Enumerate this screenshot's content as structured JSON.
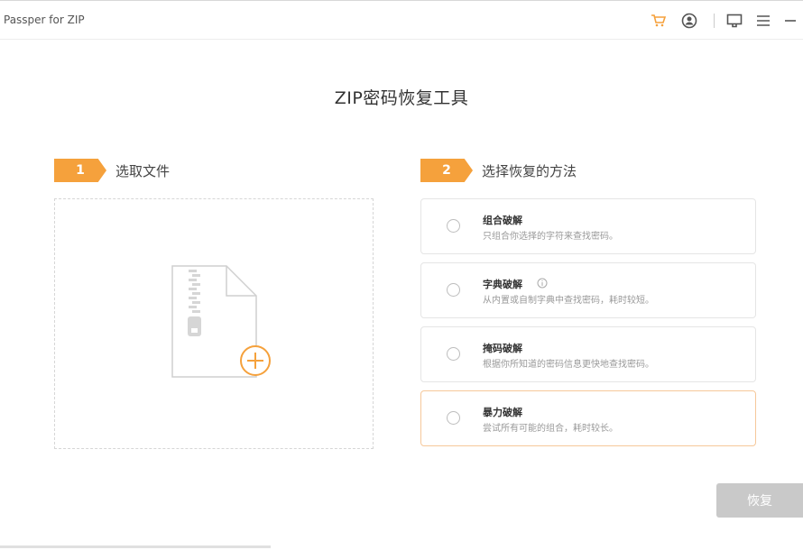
{
  "app": {
    "title": "Passper for ZIP"
  },
  "toolbar": {
    "icons": [
      "cart-icon",
      "user-account-icon",
      "feedback-icon",
      "menu-icon",
      "minimize-icon"
    ],
    "accent_color": "#f5a13c"
  },
  "main": {
    "heading": "ZIP密码恢复工具",
    "step1": {
      "number": "1",
      "label": "选取文件"
    },
    "step2": {
      "number": "2",
      "label": "选择恢复的方法"
    },
    "methods": [
      {
        "name": "组合破解",
        "desc": "只组合你选择的字符来查找密码。",
        "selected": false
      },
      {
        "name": "字典破解",
        "desc": "从内置或自制字典中查找密码，耗时较短。",
        "selected": false,
        "info_icon": "info-icon"
      },
      {
        "name": "掩码破解",
        "desc": "根据你所知道的密码信息更快地查找密码。",
        "selected": false
      },
      {
        "name": "暴力破解",
        "desc": "尝试所有可能的组合，耗时较长。",
        "selected": false
      }
    ]
  },
  "footer": {
    "recover_label": "恢复",
    "button_color": "#c9c9c9"
  }
}
